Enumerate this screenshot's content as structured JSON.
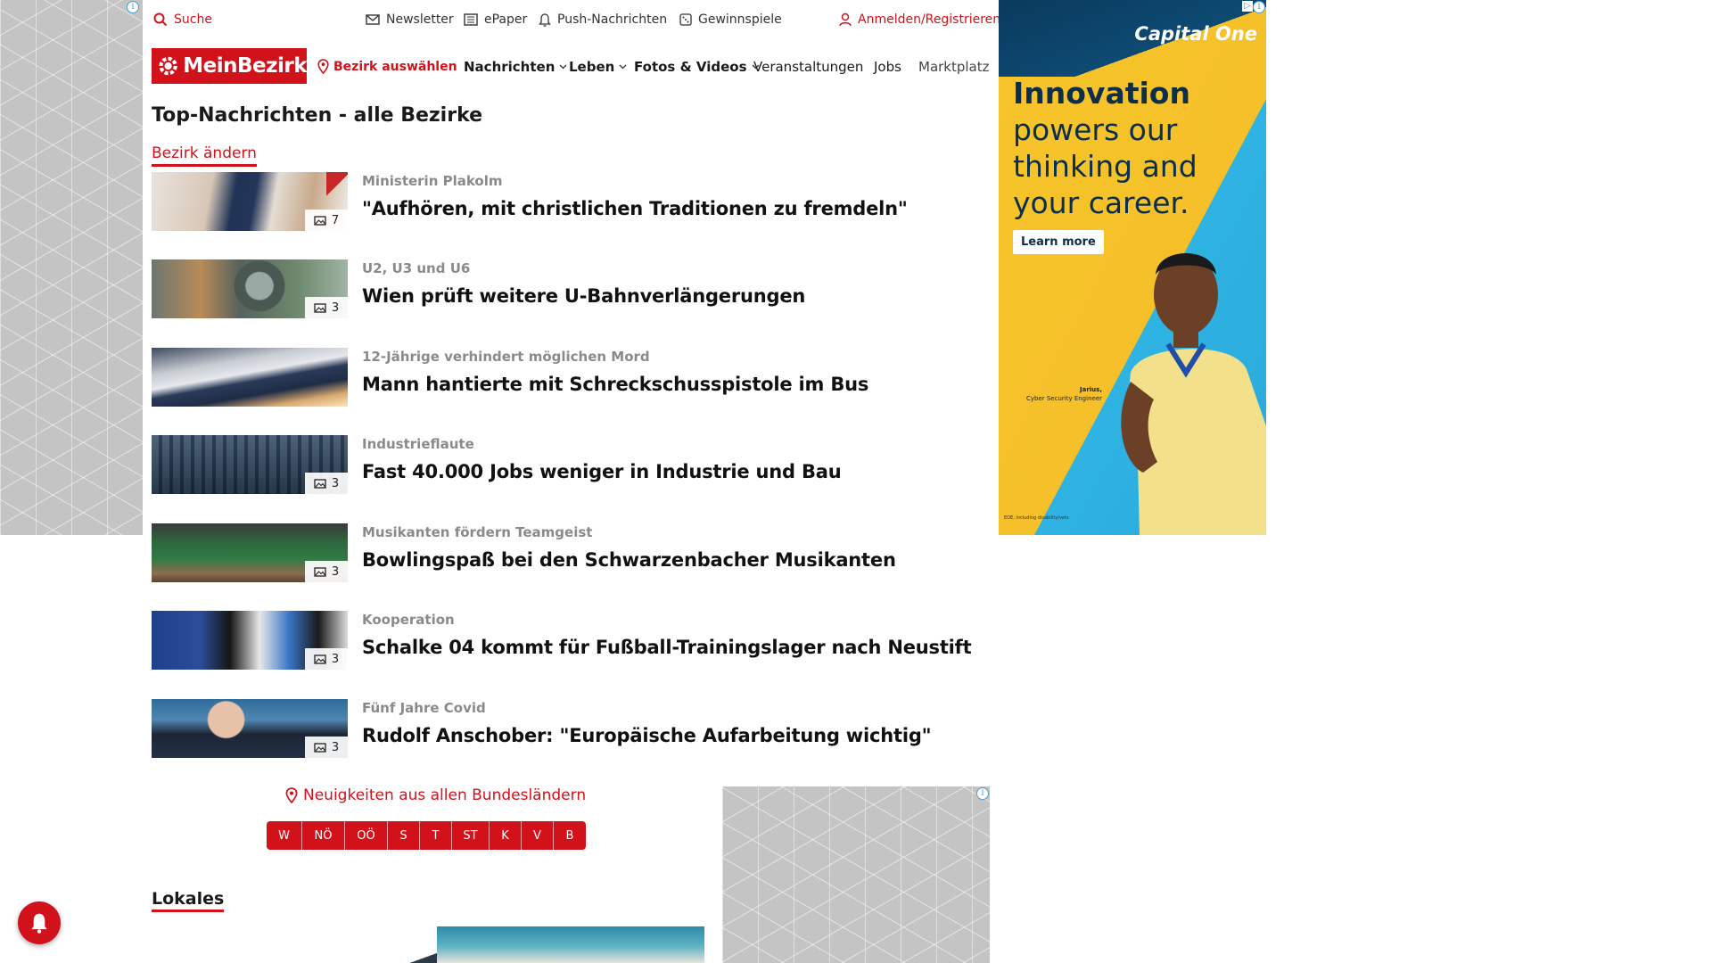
{
  "brand": {
    "name": "MeinBezirk",
    "accent": "#d1121a"
  },
  "utility_bar": {
    "search": "Suche",
    "newsletter": "Newsletter",
    "epaper": "ePaper",
    "push": "Push-Nachrichten",
    "gewinnspiele": "Gewinnspiele",
    "login": "Anmelden/Registrieren"
  },
  "nav": {
    "bezirk": "Bezirk auswählen",
    "items": [
      {
        "label": "Nachrichten",
        "has_menu": true
      },
      {
        "label": "Leben",
        "has_menu": true
      },
      {
        "label": "Fotos & Videos",
        "has_menu": true
      },
      {
        "label": "Veranstaltungen",
        "has_menu": false
      },
      {
        "label": "Jobs",
        "has_menu": false
      },
      {
        "label": "Marktplatz",
        "has_menu": false
      }
    ]
  },
  "main": {
    "title": "Top-Nachrichten - alle Bezirke",
    "change_bezirk": "Bezirk ändern",
    "articles": [
      {
        "kicker": "Ministerin Plakolm",
        "headline": "\"Aufhören, mit christlichen Traditionen zu fremdeln\"",
        "photo_count": "7"
      },
      {
        "kicker": "U2, U3 und U6",
        "headline": "Wien prüft weitere U-Bahnverlängerungen",
        "photo_count": "3"
      },
      {
        "kicker": "12-Jährige verhindert möglichen Mord",
        "headline": "Mann hantierte mit Schreckschusspistole im Bus",
        "photo_count": ""
      },
      {
        "kicker": "Industrieflaute",
        "headline": "Fast 40.000 Jobs weniger in Industrie und Bau",
        "photo_count": "3"
      },
      {
        "kicker": "Musikanten fördern Teamgeist",
        "headline": "Bowlingspaß bei den Schwarzenbacher Musikanten",
        "photo_count": "3"
      },
      {
        "kicker": "Kooperation",
        "headline": "Schalke 04 kommt für Fußball-Trainingslager nach Neustift",
        "photo_count": "3"
      },
      {
        "kicker": "Fünf Jahre Covid",
        "headline": "Rudolf Anschober: \"Europäische Aufarbeitung wichtig\"",
        "photo_count": "3"
      }
    ],
    "states_link": "Neuigkeiten aus allen Bundesländern",
    "states": [
      "W",
      "NÖ",
      "OÖ",
      "S",
      "T",
      "ST",
      "K",
      "V",
      "B"
    ],
    "lokales": "Lokales"
  },
  "ad": {
    "logo": "Capital One",
    "headline_bold": "Innovation",
    "headline_rest": "powers our thinking and your career.",
    "cta": "Learn more",
    "person_name": "Jarius,",
    "person_title": "Cyber Security Engineer",
    "disclaimer": "EOE, including disability/vets"
  }
}
